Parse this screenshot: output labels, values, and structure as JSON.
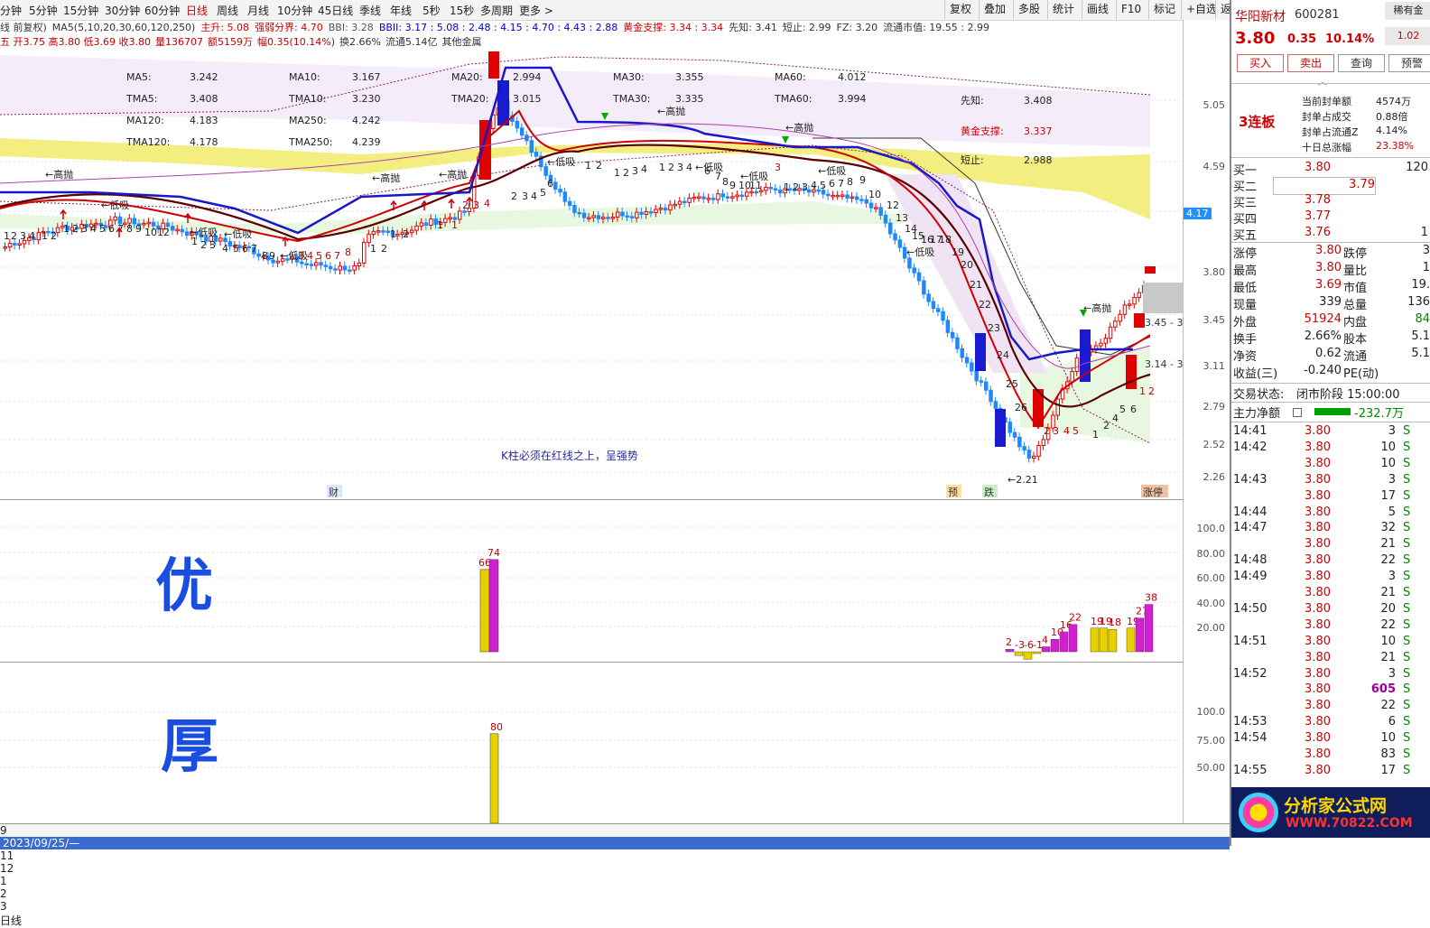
{
  "period_bar": {
    "items": [
      "分钟",
      "5分钟",
      "15分钟",
      "30分钟",
      "60分钟",
      "日线",
      "周线",
      "月线",
      "10分钟",
      "45日线",
      "季线",
      "年线",
      "5秒",
      "15秒",
      "多周期",
      "更多 >"
    ],
    "active": "日线"
  },
  "toolbar": {
    "items": [
      "复权",
      "叠加",
      "多股",
      "统计",
      "画线",
      "F10",
      "标记",
      "+自选",
      "返回"
    ]
  },
  "indicator_row": {
    "items": [
      "线 前复权)",
      "MA5(5,10,20,30,60,120,250)",
      "主升: 5.08",
      "强弱分界: 4.70",
      "BBI: 3.28",
      "BBII: 3.17 : 5.08 : 2.48 : 4.15 : 4.70 : 4.43 : 2.88",
      "黄金支撑: 3.34 : 3.34",
      "先知: 3.41",
      "短止: 2.99",
      "FZ: 3.20",
      "流通市值: 19.55 : 2.99"
    ]
  },
  "info_row": {
    "items": [
      "五 开3.75 高3.80 低3.69 收3.80",
      "量136707",
      "额5159万",
      "幅0.35(10.14%)",
      "换2.66%",
      "流通5.14亿",
      "其他金属"
    ]
  },
  "ma_table": [
    {
      "label": "MA5:",
      "value": "3.242"
    },
    {
      "label": "MA10:",
      "value": "3.167"
    },
    {
      "label": "MA20:",
      "value": "2.994"
    },
    {
      "label": "MA30:",
      "value": "3.355"
    },
    {
      "label": "MA60:",
      "value": "4.012"
    },
    {
      "label": "TMA5:",
      "value": "3.408"
    },
    {
      "label": "TMA10:",
      "value": "3.230"
    },
    {
      "label": "TMA20:",
      "value": "3.015"
    },
    {
      "label": "TMA30:",
      "value": "3.335"
    },
    {
      "label": "TMA60:",
      "value": "3.994"
    },
    {
      "label": "MA120:",
      "value": "4.183"
    },
    {
      "label": "MA250:",
      "value": "4.242"
    },
    {
      "label": "TMA120:",
      "value": "4.178"
    },
    {
      "label": "TMA250:",
      "value": "4.239"
    }
  ],
  "side_table": [
    {
      "label": "先知:",
      "value": "3.408"
    },
    {
      "label": "黄金支撑:",
      "value": "3.337"
    },
    {
      "label": "短止:",
      "value": "2.988"
    }
  ],
  "chart_note": "K柱必须在红线之上，呈强势",
  "chart_annotations": [
    "←高抛",
    "←低吸",
    "←2.21",
    "财",
    "预",
    "跌",
    "涨停",
    "3.45 - 3.",
    "3.14 - 3.1"
  ],
  "price_axis": [
    "5.05",
    "4.59",
    "4.17",
    "3.80",
    "3.45",
    "3.11",
    "2.79",
    "2.52",
    "2.26"
  ],
  "sub1_axis": [
    "100.0",
    "80.00",
    "60.00",
    "40.00",
    "20.00"
  ],
  "sub2_axis": [
    "100.0",
    "75.00",
    "50.00"
  ],
  "date_axis": [
    "9",
    "2023/09/25/—",
    "11",
    "12",
    "1",
    "2",
    "3",
    "日线"
  ],
  "handwriting": {
    "top": "优",
    "bottom": "厚"
  },
  "sub1_labels": [
    "66",
    "74",
    "2",
    "-3",
    "-6",
    "-1",
    "4",
    "10",
    "16",
    "22",
    "19",
    "19",
    "18",
    "19",
    "27",
    "38"
  ],
  "sub2_labels": [
    "80"
  ],
  "chart_data": [
    {
      "type": "bar",
      "title": "",
      "series": [
        {
          "name": "",
          "values": [
            66,
            74
          ]
        },
        {
          "name": "",
          "values": [
            2,
            -3,
            -6,
            -1,
            4,
            10,
            16,
            22,
            19,
            19,
            18,
            19,
            27,
            38
          ]
        }
      ],
      "ylim": [
        0,
        100
      ]
    },
    {
      "type": "bar",
      "title": "",
      "series": [
        {
          "name": "",
          "values": [
            80
          ]
        }
      ],
      "ylim": [
        0,
        100
      ]
    }
  ],
  "stock": {
    "name": "华阳新材",
    "code": "600281",
    "price": "3.80",
    "change": "0.35",
    "pct": "10.14%",
    "side_badge": "稀有金",
    "side_value": "1.02"
  },
  "buttons": [
    "买入",
    "卖出",
    "查询",
    "预警"
  ],
  "limit_info": {
    "tag": "3连板",
    "rows": [
      {
        "label": "当前封单额",
        "value": "4574万"
      },
      {
        "label": "封单占成交",
        "value": "0.88倍"
      },
      {
        "label": "封单占流通Z",
        "value": "4.14%"
      },
      {
        "label": "十日总涨幅",
        "value": "23.38%"
      }
    ]
  },
  "bids": [
    {
      "label": "买一",
      "price": "3.80",
      "vol": "120"
    },
    {
      "label": "买二",
      "price": "3.79",
      "vol": ""
    },
    {
      "label": "买三",
      "price": "3.78",
      "vol": ""
    },
    {
      "label": "买四",
      "price": "3.77",
      "vol": ""
    },
    {
      "label": "买五",
      "price": "3.76",
      "vol": "1"
    }
  ],
  "quote": [
    {
      "l1": "涨停",
      "v1": "3.80",
      "l2": "跌停",
      "v2": "3"
    },
    {
      "l1": "最高",
      "v1": "3.80",
      "l2": "量比",
      "v2": "1"
    },
    {
      "l1": "最低",
      "v1": "3.69",
      "l2": "市值",
      "v2": "19."
    },
    {
      "l1": "现量",
      "v1": "339",
      "l2": "总量",
      "v2": "136"
    },
    {
      "l1": "外盘",
      "v1": "51924",
      "l2": "内盘",
      "v2": "84"
    },
    {
      "l1": "换手",
      "v1": "2.66%",
      "l2": "股本",
      "v2": "5.1"
    },
    {
      "l1": "净资",
      "v1": "0.62",
      "l2": "流通",
      "v2": "5.1"
    },
    {
      "l1": "收益(三)",
      "v1": "-0.240",
      "l2": "PE(动)",
      "v2": ""
    }
  ],
  "trade_status": {
    "label": "交易状态:",
    "value": "闭市阶段 15:00:00"
  },
  "main_flow": {
    "label": "主力净额",
    "value": "-232.7万"
  },
  "ticks": [
    {
      "t": "14:41",
      "p": "3.80",
      "v": "3",
      "s": "S"
    },
    {
      "t": "14:42",
      "p": "3.80",
      "v": "10",
      "s": "S"
    },
    {
      "t": "",
      "p": "3.80",
      "v": "10",
      "s": "S"
    },
    {
      "t": "14:43",
      "p": "3.80",
      "v": "3",
      "s": "S"
    },
    {
      "t": "",
      "p": "3.80",
      "v": "17",
      "s": "S"
    },
    {
      "t": "14:44",
      "p": "3.80",
      "v": "5",
      "s": "S"
    },
    {
      "t": "14:47",
      "p": "3.80",
      "v": "32",
      "s": "S"
    },
    {
      "t": "",
      "p": "3.80",
      "v": "21",
      "s": "S"
    },
    {
      "t": "14:48",
      "p": "3.80",
      "v": "22",
      "s": "S"
    },
    {
      "t": "14:49",
      "p": "3.80",
      "v": "3",
      "s": "S"
    },
    {
      "t": "",
      "p": "3.80",
      "v": "21",
      "s": "S"
    },
    {
      "t": "14:50",
      "p": "3.80",
      "v": "20",
      "s": "S"
    },
    {
      "t": "",
      "p": "3.80",
      "v": "22",
      "s": "S"
    },
    {
      "t": "14:51",
      "p": "3.80",
      "v": "10",
      "s": "S"
    },
    {
      "t": "",
      "p": "3.80",
      "v": "21",
      "s": "S"
    },
    {
      "t": "14:52",
      "p": "3.80",
      "v": "3",
      "s": "S"
    },
    {
      "t": "",
      "p": "3.80",
      "v": "605",
      "s": "S"
    },
    {
      "t": "",
      "p": "3.80",
      "v": "22",
      "s": "S"
    },
    {
      "t": "14:53",
      "p": "3.80",
      "v": "6",
      "s": "S"
    },
    {
      "t": "14:54",
      "p": "3.80",
      "v": "10",
      "s": "S"
    },
    {
      "t": "",
      "p": "3.80",
      "v": "83",
      "s": "S"
    },
    {
      "t": "14:55",
      "p": "3.80",
      "v": "17",
      "s": "S"
    }
  ],
  "watermark": {
    "line1": "分析家公式网",
    "line2": "WWW.70822.COM"
  }
}
